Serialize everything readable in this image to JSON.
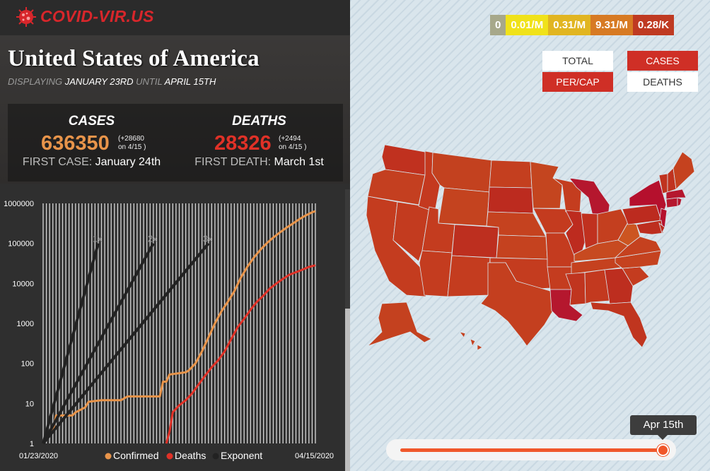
{
  "app": {
    "title": "COVID-VIR.US",
    "logo_icon": "virus-icon"
  },
  "header": {
    "country": "United States of America",
    "displaying_label": "DISPLAYING",
    "start_date": "JANUARY 23RD",
    "until_label": "UNTIL",
    "end_date": "APRIL 15TH"
  },
  "stats": {
    "cases": {
      "title": "CASES",
      "value": "636350",
      "delta_line1": "(+28680",
      "delta_line2": "on 4/15 )",
      "first_label": "FIRST CASE:",
      "first_value": "January 24th",
      "color": "#e8944a"
    },
    "deaths": {
      "title": "DEATHS",
      "value": "28326",
      "delta_line1": "(+2494",
      "delta_line2": "on 4/15 )",
      "first_label": "FIRST DEATH:",
      "first_value": "March 1st",
      "color": "#e03127"
    }
  },
  "scale": [
    {
      "label": "0",
      "color": "#a7a88a"
    },
    {
      "label": "0.01/M",
      "color": "#f0e21a"
    },
    {
      "label": "0.31/M",
      "color": "#e1b521"
    },
    {
      "label": "9.31/M",
      "color": "#d77a23"
    },
    {
      "label": "0.28/K",
      "color": "#bf3a22"
    }
  ],
  "toggles": {
    "total": "TOTAL",
    "per_cap": "PER/CAP",
    "cases": "CASES",
    "deaths": "DEATHS"
  },
  "slider": {
    "tooltip": "Apr 15th",
    "position": 1.0
  },
  "chart_data": {
    "type": "line",
    "y_scale": "log",
    "ylim": [
      1,
      1000000
    ],
    "y_ticks": [
      "1000000",
      "100000",
      "10000",
      "1000",
      "100",
      "10",
      "1"
    ],
    "x_start_label": "01/23/2020",
    "x_end_label": "04/15/2020",
    "x_days": 84,
    "legend": [
      {
        "name": "Confirmed",
        "color": "#e8944a"
      },
      {
        "name": "Deaths",
        "color": "#e03127"
      },
      {
        "name": "Exponent",
        "color": "#222222"
      }
    ],
    "exponent_labels": [
      "1x",
      "2x",
      "3x"
    ],
    "series": [
      {
        "name": "Confirmed",
        "color": "#e8944a",
        "points": [
          [
            0,
            1
          ],
          [
            2,
            2
          ],
          [
            3,
            2
          ],
          [
            4,
            5
          ],
          [
            9,
            5
          ],
          [
            10,
            6
          ],
          [
            13,
            8
          ],
          [
            14,
            11
          ],
          [
            18,
            12
          ],
          [
            24,
            12
          ],
          [
            26,
            15
          ],
          [
            36,
            15
          ],
          [
            37,
            35
          ],
          [
            38,
            35
          ],
          [
            39,
            53
          ],
          [
            42,
            57
          ],
          [
            44,
            60
          ],
          [
            45,
            68
          ],
          [
            47,
            100
          ],
          [
            49,
            200
          ],
          [
            51,
            450
          ],
          [
            53,
            1000
          ],
          [
            55,
            2000
          ],
          [
            57,
            3500
          ],
          [
            59,
            6400
          ],
          [
            61,
            14000
          ],
          [
            63,
            26000
          ],
          [
            65,
            44000
          ],
          [
            67,
            69000
          ],
          [
            69,
            101000
          ],
          [
            71,
            140000
          ],
          [
            73,
            187000
          ],
          [
            75,
            245000
          ],
          [
            77,
            312000
          ],
          [
            79,
            400000
          ],
          [
            81,
            500000
          ],
          [
            83,
            600000
          ],
          [
            84,
            636350
          ]
        ]
      },
      {
        "name": "Deaths",
        "color": "#e03127",
        "points": [
          [
            38,
            1
          ],
          [
            39,
            2
          ],
          [
            40,
            6
          ],
          [
            42,
            9
          ],
          [
            44,
            12
          ],
          [
            46,
            18
          ],
          [
            48,
            30
          ],
          [
            50,
            50
          ],
          [
            52,
            80
          ],
          [
            54,
            120
          ],
          [
            56,
            200
          ],
          [
            58,
            400
          ],
          [
            60,
            800
          ],
          [
            62,
            1300
          ],
          [
            64,
            2200
          ],
          [
            66,
            3500
          ],
          [
            68,
            5000
          ],
          [
            70,
            7500
          ],
          [
            72,
            10000
          ],
          [
            74,
            13000
          ],
          [
            76,
            16500
          ],
          [
            78,
            19000
          ],
          [
            80,
            22000
          ],
          [
            82,
            25800
          ],
          [
            84,
            28326
          ]
        ]
      },
      {
        "name": "Exponent 1x",
        "color": "#222222",
        "points": [
          [
            0,
            1
          ],
          [
            17,
            100000
          ]
        ]
      },
      {
        "name": "Exponent 2x",
        "color": "#222222",
        "points": [
          [
            0,
            1
          ],
          [
            34,
            100000
          ]
        ]
      },
      {
        "name": "Exponent 3x",
        "color": "#222222",
        "points": [
          [
            0,
            1
          ],
          [
            51,
            100000
          ]
        ]
      }
    ]
  },
  "map": {
    "states": [
      {
        "name": "WA",
        "color": "#c0311f"
      },
      {
        "name": "OR",
        "color": "#c43f20"
      },
      {
        "name": "CA",
        "color": "#c43c1f"
      },
      {
        "name": "NV",
        "color": "#c33b1f"
      },
      {
        "name": "ID",
        "color": "#c4391f"
      },
      {
        "name": "MT",
        "color": "#c3411f"
      },
      {
        "name": "WY",
        "color": "#c4431f"
      },
      {
        "name": "UT",
        "color": "#c43c1f"
      },
      {
        "name": "AZ",
        "color": "#c43c1f"
      },
      {
        "name": "CO",
        "color": "#bd2f1f"
      },
      {
        "name": "NM",
        "color": "#c43c1f"
      },
      {
        "name": "ND",
        "color": "#c43f1f"
      },
      {
        "name": "SD",
        "color": "#bc2b1f"
      },
      {
        "name": "NE",
        "color": "#c5421f"
      },
      {
        "name": "KS",
        "color": "#c5421f"
      },
      {
        "name": "OK",
        "color": "#c43c1f"
      },
      {
        "name": "TX",
        "color": "#c43f1f"
      },
      {
        "name": "MN",
        "color": "#c4451f"
      },
      {
        "name": "IA",
        "color": "#c43b1f"
      },
      {
        "name": "MO",
        "color": "#c43b1f"
      },
      {
        "name": "AR",
        "color": "#c43c1f"
      },
      {
        "name": "LA",
        "color": "#b5172e"
      },
      {
        "name": "WI",
        "color": "#c43d1f"
      },
      {
        "name": "IL",
        "color": "#bd2b1f"
      },
      {
        "name": "MI",
        "color": "#b5172e"
      },
      {
        "name": "IN",
        "color": "#c0311f"
      },
      {
        "name": "OH",
        "color": "#c43f1f"
      },
      {
        "name": "KY",
        "color": "#c74a20"
      },
      {
        "name": "TN",
        "color": "#c5411f"
      },
      {
        "name": "MS",
        "color": "#c0351f"
      },
      {
        "name": "AL",
        "color": "#c3391f"
      },
      {
        "name": "GA",
        "color": "#bd2e1f"
      },
      {
        "name": "FL",
        "color": "#c0351f"
      },
      {
        "name": "SC",
        "color": "#c43c1f"
      },
      {
        "name": "NC",
        "color": "#c5421f"
      },
      {
        "name": "VA",
        "color": "#c5411f"
      },
      {
        "name": "WV",
        "color": "#cc5521"
      },
      {
        "name": "PA",
        "color": "#bc2b1f"
      },
      {
        "name": "NY",
        "color": "#b5102d"
      },
      {
        "name": "NJ",
        "color": "#b5102d"
      },
      {
        "name": "CT",
        "color": "#b5172e"
      },
      {
        "name": "MA",
        "color": "#b5172e"
      },
      {
        "name": "VT",
        "color": "#c0331f"
      },
      {
        "name": "NH",
        "color": "#c0331f"
      },
      {
        "name": "ME",
        "color": "#c5421f"
      },
      {
        "name": "MD",
        "color": "#bd2e1f"
      },
      {
        "name": "DE",
        "color": "#bc2b1f"
      },
      {
        "name": "RI",
        "color": "#b5172e"
      },
      {
        "name": "AK",
        "color": "#c4411f"
      },
      {
        "name": "HI",
        "color": "#c4411f"
      }
    ]
  }
}
